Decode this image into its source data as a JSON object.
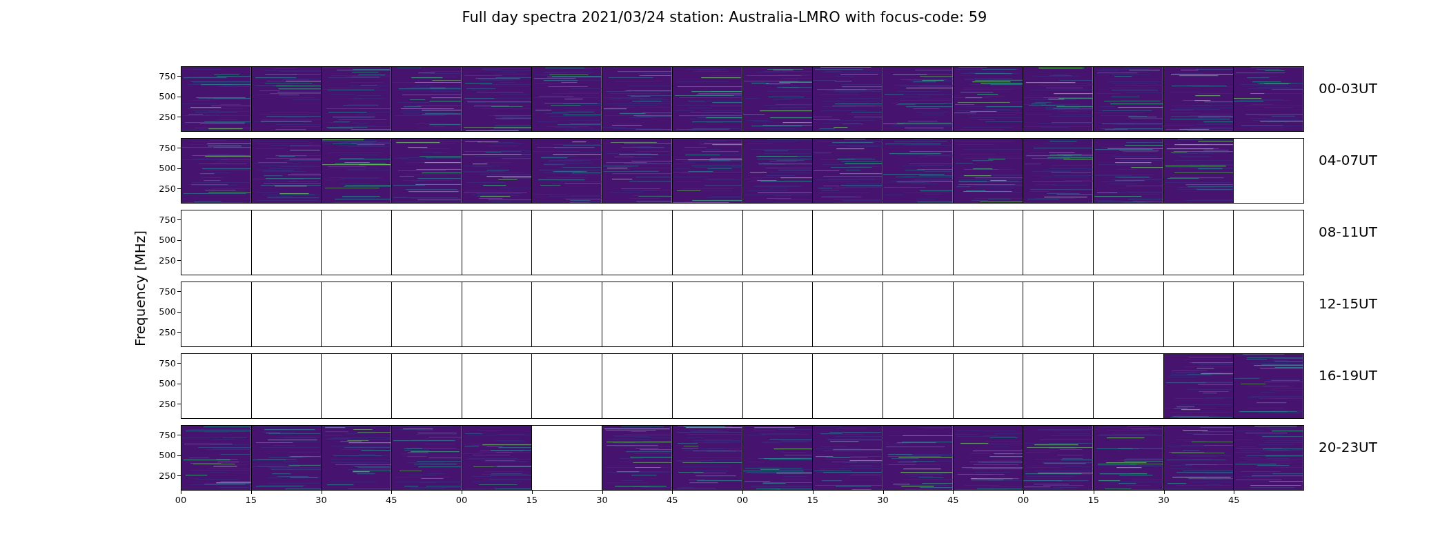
{
  "title": "Full day spectra 2021/03/24 station: Australia-LMRO with focus-code: 59",
  "ylabel": "Frequency [MHz]",
  "xticks": [
    "00",
    "15",
    "30",
    "45",
    "00",
    "15",
    "30",
    "45",
    "00",
    "15",
    "30",
    "45",
    "00",
    "15",
    "30",
    "45"
  ],
  "rows": [
    {
      "label": "00-03UT",
      "yticks": [
        "750",
        "500",
        "250"
      ],
      "cells": [
        {
          "filled": true
        },
        {
          "filled": true
        },
        {
          "filled": true
        },
        {
          "filled": true
        },
        {
          "filled": true
        },
        {
          "filled": true
        },
        {
          "filled": true
        },
        {
          "filled": true
        },
        {
          "filled": true
        },
        {
          "filled": true
        },
        {
          "filled": true
        },
        {
          "filled": true
        },
        {
          "filled": true
        },
        {
          "filled": true
        },
        {
          "filled": true
        },
        {
          "filled": true
        }
      ]
    },
    {
      "label": "04-07UT",
      "yticks": [
        "750",
        "500",
        "250"
      ],
      "cells": [
        {
          "filled": true
        },
        {
          "filled": true
        },
        {
          "filled": true
        },
        {
          "filled": true
        },
        {
          "filled": true
        },
        {
          "filled": true
        },
        {
          "filled": true
        },
        {
          "filled": true
        },
        {
          "filled": true
        },
        {
          "filled": true
        },
        {
          "filled": true
        },
        {
          "filled": true
        },
        {
          "filled": true
        },
        {
          "filled": true
        },
        {
          "filled": true
        },
        {
          "filled": false
        }
      ]
    },
    {
      "label": "08-11UT",
      "yticks": [
        "750",
        "500",
        "250"
      ],
      "cells": [
        {
          "filled": false
        },
        {
          "filled": false
        },
        {
          "filled": false
        },
        {
          "filled": false
        },
        {
          "filled": false
        },
        {
          "filled": false
        },
        {
          "filled": false
        },
        {
          "filled": false
        },
        {
          "filled": false
        },
        {
          "filled": false
        },
        {
          "filled": false
        },
        {
          "filled": false
        },
        {
          "filled": false
        },
        {
          "filled": false
        },
        {
          "filled": false
        },
        {
          "filled": false
        }
      ]
    },
    {
      "label": "12-15UT",
      "yticks": [
        "750",
        "500",
        "250"
      ],
      "cells": [
        {
          "filled": false
        },
        {
          "filled": false
        },
        {
          "filled": false
        },
        {
          "filled": false
        },
        {
          "filled": false
        },
        {
          "filled": false
        },
        {
          "filled": false
        },
        {
          "filled": false
        },
        {
          "filled": false
        },
        {
          "filled": false
        },
        {
          "filled": false
        },
        {
          "filled": false
        },
        {
          "filled": false
        },
        {
          "filled": false
        },
        {
          "filled": false
        },
        {
          "filled": false
        }
      ]
    },
    {
      "label": "16-19UT",
      "yticks": [
        "750",
        "500",
        "250"
      ],
      "cells": [
        {
          "filled": false
        },
        {
          "filled": false
        },
        {
          "filled": false
        },
        {
          "filled": false
        },
        {
          "filled": false
        },
        {
          "filled": false
        },
        {
          "filled": false
        },
        {
          "filled": false
        },
        {
          "filled": false
        },
        {
          "filled": false
        },
        {
          "filled": false
        },
        {
          "filled": false
        },
        {
          "filled": false
        },
        {
          "filled": false
        },
        {
          "filled": true
        },
        {
          "filled": true
        }
      ]
    },
    {
      "label": "20-23UT",
      "yticks": [
        "750",
        "500",
        "250"
      ],
      "cells": [
        {
          "filled": true
        },
        {
          "filled": true
        },
        {
          "filled": true
        },
        {
          "filled": true
        },
        {
          "filled": true
        },
        {
          "filled": false
        },
        {
          "filled": true
        },
        {
          "filled": true
        },
        {
          "filled": true
        },
        {
          "filled": true
        },
        {
          "filled": true
        },
        {
          "filled": true
        },
        {
          "filled": true
        },
        {
          "filled": true
        },
        {
          "filled": true
        },
        {
          "filled": true
        }
      ]
    }
  ]
}
